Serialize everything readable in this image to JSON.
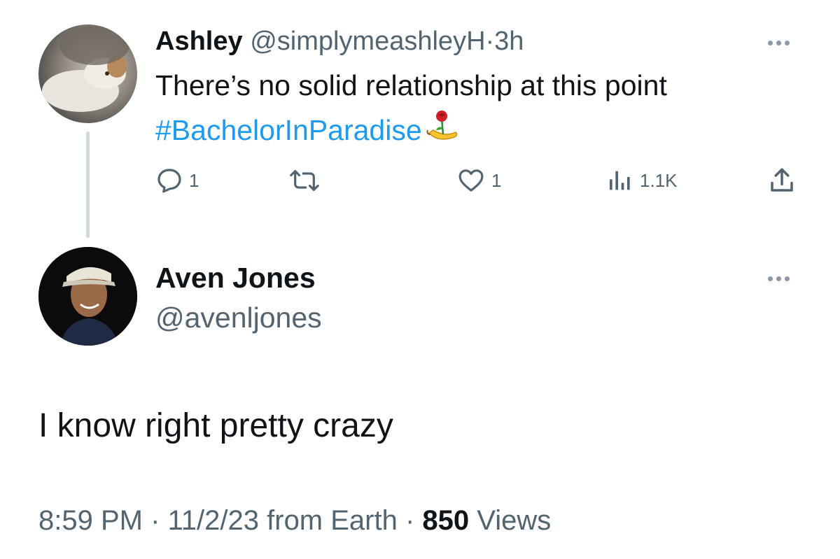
{
  "parent_tweet": {
    "author_name": "Ashley",
    "handle": "@simplymeashleyH",
    "separator": "·",
    "time": "3h",
    "text": "There’s no solid relationship at this point",
    "hashtag": "#BachelorInParadise",
    "emoji_icons": [
      "rose-icon",
      "banana-icon"
    ],
    "actions": {
      "reply_count": "1",
      "retweet_count": "",
      "like_count": "1",
      "views_count": "1.1K"
    }
  },
  "reply_tweet": {
    "author_name": "Aven Jones",
    "handle": "@avenljones",
    "text": "I know right pretty crazy",
    "meta": {
      "time": "8:59 PM",
      "sep1": " · ",
      "date": "11/2/23",
      "source": " from Earth",
      "sep2": " · ",
      "views_count": "850",
      "views_label": " Views"
    }
  },
  "colors": {
    "text_primary": "#0f1419",
    "text_secondary": "#536471",
    "link": "#1d9bf0",
    "thread_line": "#cfd9de"
  }
}
